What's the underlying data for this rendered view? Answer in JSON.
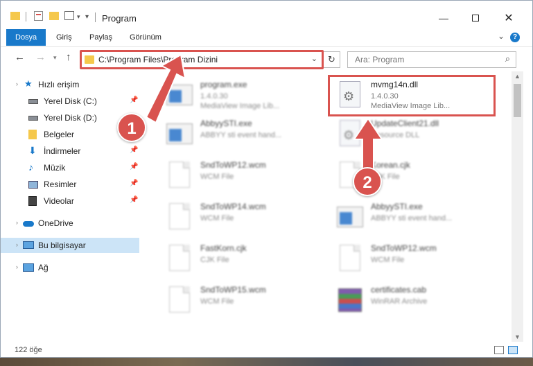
{
  "window": {
    "title": "Program"
  },
  "ribbon": {
    "tabs": [
      "Dosya",
      "Giriş",
      "Paylaş",
      "Görünüm"
    ]
  },
  "address": {
    "path": "C:\\Program Files\\Program Dizini"
  },
  "search": {
    "placeholder": "Ara: Program"
  },
  "sidebar": {
    "items": [
      {
        "label": "Hızlı erişim",
        "icon": "star-icon"
      },
      {
        "label": "Yerel Disk (C:)",
        "icon": "drive-icon"
      },
      {
        "label": "Yerel Disk (D:)",
        "icon": "drive-icon"
      },
      {
        "label": "Belgeler",
        "icon": "documents-icon"
      },
      {
        "label": "İndirmeler",
        "icon": "download-icon"
      },
      {
        "label": "Müzik",
        "icon": "music-icon"
      },
      {
        "label": "Resimler",
        "icon": "pictures-icon"
      },
      {
        "label": "Videolar",
        "icon": "videos-icon"
      },
      {
        "label": "OneDrive",
        "icon": "cloud-icon"
      },
      {
        "label": "Bu bilgisayar",
        "icon": "computer-icon"
      },
      {
        "label": "Ağ",
        "icon": "network-icon"
      }
    ]
  },
  "files": [
    {
      "name": "program.exe",
      "line2": "1.4.0.30",
      "line3": "MediaView Image Lib...",
      "icon": "app-icon"
    },
    {
      "name": "mvmg14n.dll",
      "line2": "1.4.0.30",
      "line3": "MediaView Image Lib...",
      "icon": "dll-icon"
    },
    {
      "name": "AbbyySTI.exe",
      "line2": "ABBYY sti event hand...",
      "line3": "",
      "icon": "app-icon"
    },
    {
      "name": "UpdateClient21.dll",
      "line2": "Resource DLL",
      "line3": "",
      "icon": "dll-icon"
    },
    {
      "name": "SndToWP12.wcm",
      "line2": "WCM File",
      "line3": "",
      "icon": "file-icon"
    },
    {
      "name": "Korean.cjk",
      "line2": "CJK File",
      "line3": "",
      "icon": "file-icon"
    },
    {
      "name": "SndToWP14.wcm",
      "line2": "WCM File",
      "line3": "",
      "icon": "file-icon"
    },
    {
      "name": "AbbyySTI.exe",
      "line2": "ABBYY sti event hand...",
      "line3": "",
      "icon": "app-icon"
    },
    {
      "name": "FastKorn.cjk",
      "line2": "CJK File",
      "line3": "",
      "icon": "file-icon"
    },
    {
      "name": "SndToWP12.wcm",
      "line2": "WCM File",
      "line3": "",
      "icon": "file-icon"
    },
    {
      "name": "SndToWP15.wcm",
      "line2": "WCM File",
      "line3": "",
      "icon": "file-icon"
    },
    {
      "name": "certificates.cab",
      "line2": "WinRAR Archive",
      "line3": "",
      "icon": "archive-icon"
    }
  ],
  "annotations": {
    "step1": "1",
    "step2": "2"
  },
  "status": {
    "count": "122 öğe"
  },
  "colors": {
    "accent": "#1979ca",
    "highlight": "#d9534f",
    "folder": "#f5c84c",
    "selection": "#cce4f7"
  }
}
